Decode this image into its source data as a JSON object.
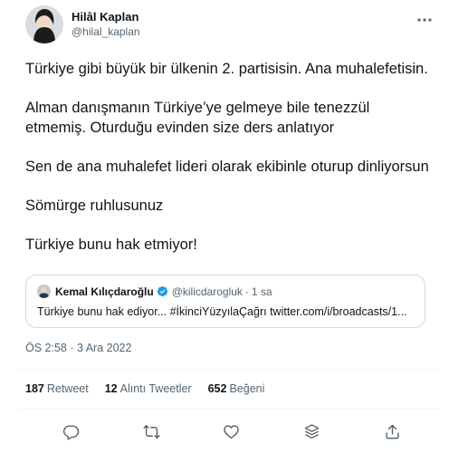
{
  "author": {
    "name": "Hilâl Kaplan",
    "handle": "@hilal_kaplan"
  },
  "tweet": {
    "paragraphs": [
      "Türkiye gibi büyük bir ülkenin 2. partisisin. Ana muhalefetisin.",
      "Alman danışmanın Türkiye’ye gelmeye bile tenezzül etmemiş. Oturduğu evinden size ders anlatıyor",
      "Sen de ana muhalefet lideri olarak ekibinle oturup dinliyorsun",
      "Sömürge ruhlusunuz",
      "Türkiye bunu hak etmiyor!"
    ]
  },
  "quote": {
    "name": "Kemal Kılıçdaroğlu",
    "handle": "@kilicdarogluk",
    "separator": "·",
    "time": "1 sa",
    "text": "Türkiye bunu hak ediyor... #İkinciYüzyılaÇağrı twitter.com/i/broadcasts/1..."
  },
  "meta": {
    "timestamp": "ÖS 2:58 · 3 Ara 2022"
  },
  "stats": {
    "retweets_count": "187",
    "retweets_label": "Retweet",
    "quotes_count": "12",
    "quotes_label": "Alıntı Tweetler",
    "likes_count": "652",
    "likes_label": "Beğeni"
  },
  "icons": {
    "reply": "reply-icon",
    "retweet": "retweet-icon",
    "like": "heart-icon",
    "bookmark": "bookmark-stack-icon",
    "share": "share-icon",
    "more": "more-horizontal-icon",
    "verified": "verified-badge-icon"
  },
  "colors": {
    "text": "#0f1419",
    "secondary": "#536471",
    "verified": "#1d9bf0",
    "border": "#cfd9de"
  }
}
